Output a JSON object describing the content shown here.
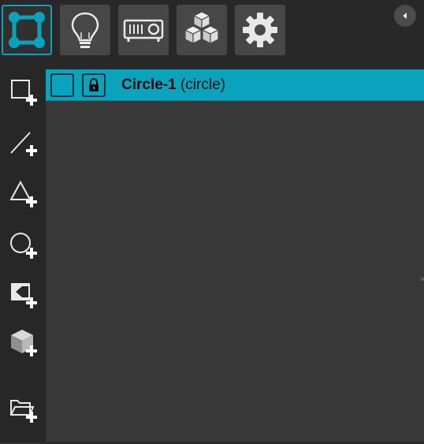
{
  "toolbar": {
    "tabs": [
      {
        "icon": "node-graph-icon",
        "active": true
      },
      {
        "icon": "lightbulb-icon",
        "active": false
      },
      {
        "icon": "projector-icon",
        "active": false
      },
      {
        "icon": "cubes-icon",
        "active": false
      },
      {
        "icon": "gear-icon",
        "active": false
      }
    ],
    "collapse_icon": "chevron-left-icon"
  },
  "sidebar": {
    "tools": [
      {
        "icon": "add-rectangle-icon"
      },
      {
        "icon": "add-line-icon"
      },
      {
        "icon": "add-triangle-icon"
      },
      {
        "icon": "add-circle-icon"
      },
      {
        "icon": "add-mask-icon"
      },
      {
        "icon": "add-cube-icon"
      },
      {
        "icon": "open-folder-add-icon"
      }
    ]
  },
  "list": {
    "rows": [
      {
        "name": "Circle-1",
        "type": "(circle)",
        "selected": true,
        "lock_icon": "lock-icon"
      }
    ]
  },
  "colors": {
    "accent": "#0aa3bd",
    "panel": "#383838",
    "sidebar": "#272727"
  }
}
